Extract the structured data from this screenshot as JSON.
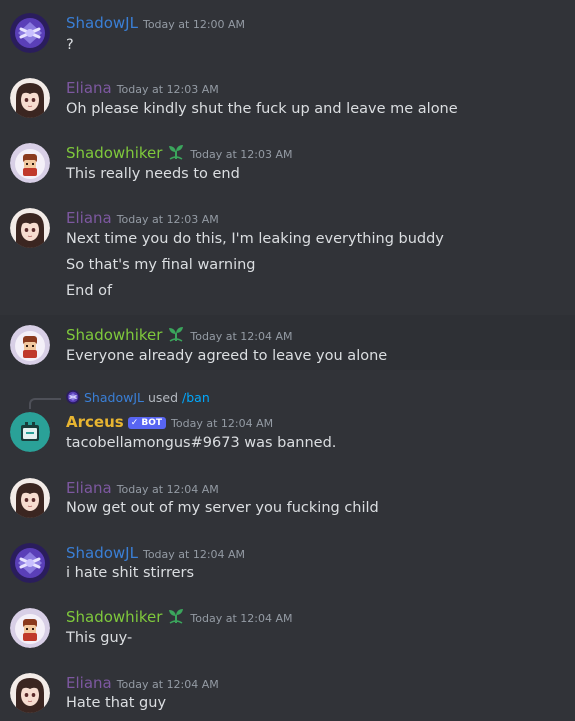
{
  "colors": {
    "shadowjl": "#3a7fd6",
    "eliana": "#7d58a0",
    "shadowhiker": "#7fc93c",
    "arceus": "#e8b531",
    "background": "#313338",
    "text": "#dbdee1",
    "timestamp": "#949ba4",
    "bot_badge": "#5865f2"
  },
  "messages": [
    {
      "author": "ShadowJL",
      "avatar": "shadowjl-avatar",
      "time": "Today at 12:00 AM",
      "lines": [
        "?"
      ]
    },
    {
      "author": "Eliana",
      "avatar": "eliana-avatar",
      "time": "Today at 12:03 AM",
      "lines": [
        "Oh please kindly shut the fuck up and leave me alone"
      ]
    },
    {
      "author": "Shadowhiker",
      "avatar": "shadowhiker-avatar",
      "time": "Today at 12:03 AM",
      "role_icon": "sprout-icon",
      "lines": [
        "This really needs to end"
      ]
    },
    {
      "author": "Eliana",
      "avatar": "eliana-avatar",
      "time": "Today at 12:03 AM",
      "lines": [
        "Next time you do this, I'm leaking everything buddy",
        "So that's my final warning",
        "End of"
      ]
    },
    {
      "author": "Shadowhiker",
      "avatar": "shadowhiker-avatar",
      "time": "Today at 12:04 AM",
      "role_icon": "sprout-icon",
      "lines": [
        "Everyone already agreed to leave you alone"
      ]
    },
    {
      "author": "Arceus",
      "avatar": "arceus-avatar",
      "time": "Today at 12:04 AM",
      "badge": "✓ BOT",
      "command": {
        "user": "ShadowJL",
        "verb": "used",
        "name": "/ban"
      },
      "lines": [
        "tacobellamongus#9673 was banned."
      ]
    },
    {
      "author": "Eliana",
      "avatar": "eliana-avatar",
      "time": "Today at 12:04 AM",
      "lines": [
        "Now get out of my server you fucking child"
      ]
    },
    {
      "author": "ShadowJL",
      "avatar": "shadowjl-avatar",
      "time": "Today at 12:04 AM",
      "lines": [
        "i hate shit stirrers"
      ]
    },
    {
      "author": "Shadowhiker",
      "avatar": "shadowhiker-avatar",
      "time": "Today at 12:04 AM",
      "role_icon": "sprout-icon",
      "lines": [
        "This guy-"
      ]
    },
    {
      "author": "Eliana",
      "avatar": "eliana-avatar",
      "time": "Today at 12:04 AM",
      "lines": [
        "Hate that guy"
      ]
    }
  ]
}
